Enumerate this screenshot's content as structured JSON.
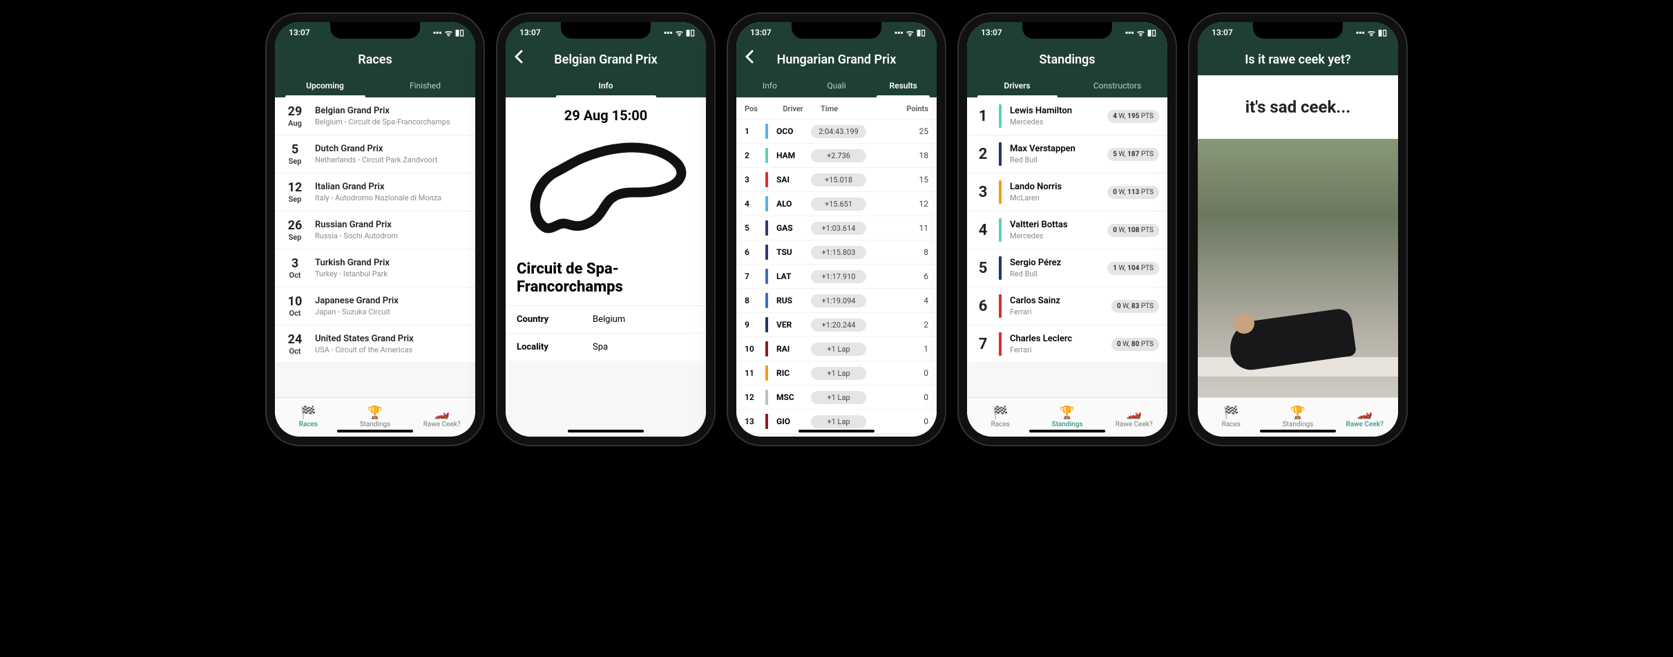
{
  "status": {
    "time": "13:07",
    "dot": "•"
  },
  "nav_labels": {
    "races": "Races",
    "standings": "Standings",
    "rawe": "Rawe Ceek?"
  },
  "screen1": {
    "title": "Races",
    "tabs": [
      "Upcoming",
      "Finished"
    ],
    "active_tab": 0,
    "races": [
      {
        "day": "29",
        "month": "Aug",
        "name": "Belgian Grand Prix",
        "loc": "Belgium - Circuit de Spa-Francorchamps"
      },
      {
        "day": "5",
        "month": "Sep",
        "name": "Dutch Grand Prix",
        "loc": "Netherlands - Circuit Park Zandvoort"
      },
      {
        "day": "12",
        "month": "Sep",
        "name": "Italian Grand Prix",
        "loc": "Italy - Autodromo Nazionale di Monza"
      },
      {
        "day": "26",
        "month": "Sep",
        "name": "Russian Grand Prix",
        "loc": "Russia - Sochi Autodrom"
      },
      {
        "day": "3",
        "month": "Oct",
        "name": "Turkish Grand Prix",
        "loc": "Turkey - Istanbul Park"
      },
      {
        "day": "10",
        "month": "Oct",
        "name": "Japanese Grand Prix",
        "loc": "Japan - Suzuka Circuit"
      },
      {
        "day": "24",
        "month": "Oct",
        "name": "United States Grand Prix",
        "loc": "USA - Circuit of the Americas"
      }
    ]
  },
  "screen2": {
    "title": "Belgian Grand Prix",
    "tab": "Info",
    "datetime": "29 Aug 15:00",
    "circuit": "Circuit de Spa-Francorchamps",
    "details": [
      {
        "k": "Country",
        "v": "Belgium"
      },
      {
        "k": "Locality",
        "v": "Spa"
      }
    ]
  },
  "screen3": {
    "title": "Hungarian Grand Prix",
    "tabs": [
      "Info",
      "Quali",
      "Results"
    ],
    "active_tab": 2,
    "columns": {
      "pos": "Pos",
      "driver": "Driver",
      "time": "Time",
      "points": "Points"
    },
    "results": [
      {
        "pos": "1",
        "code": "OCO",
        "time": "2:04:43.199",
        "pts": "25",
        "color": "#4fb5e6"
      },
      {
        "pos": "2",
        "code": "HAM",
        "time": "+2.736",
        "pts": "18",
        "color": "#5fd0b9"
      },
      {
        "pos": "3",
        "code": "SAI",
        "time": "+15.018",
        "pts": "15",
        "color": "#d92f2f"
      },
      {
        "pos": "4",
        "code": "ALO",
        "time": "+15.651",
        "pts": "12",
        "color": "#4fb5e6"
      },
      {
        "pos": "5",
        "code": "GAS",
        "time": "+1:03.614",
        "pts": "11",
        "color": "#2e3a6e"
      },
      {
        "pos": "6",
        "code": "TSU",
        "time": "+1:15.803",
        "pts": "8",
        "color": "#2e3a6e"
      },
      {
        "pos": "7",
        "code": "LAT",
        "time": "+1:17.910",
        "pts": "6",
        "color": "#3e6cc8"
      },
      {
        "pos": "8",
        "code": "RUS",
        "time": "+1:19.094",
        "pts": "4",
        "color": "#3e6cc8"
      },
      {
        "pos": "9",
        "code": "VER",
        "time": "+1:20.244",
        "pts": "2",
        "color": "#1e3866"
      },
      {
        "pos": "10",
        "code": "RAI",
        "time": "+1 Lap",
        "pts": "1",
        "color": "#8c1c1c"
      },
      {
        "pos": "11",
        "code": "RIC",
        "time": "+1 Lap",
        "pts": "0",
        "color": "#f39c12"
      },
      {
        "pos": "12",
        "code": "MSC",
        "time": "+1 Lap",
        "pts": "0",
        "color": "#bfbfbf"
      },
      {
        "pos": "13",
        "code": "GIO",
        "time": "+1 Lap",
        "pts": "0",
        "color": "#8c1c1c"
      }
    ]
  },
  "screen4": {
    "title": "Standings",
    "tabs": [
      "Drivers",
      "Constructors"
    ],
    "active_tab": 0,
    "drivers": [
      {
        "pos": "1",
        "name": "Lewis Hamilton",
        "team": "Mercedes",
        "wins": "4",
        "pts": "195",
        "color": "#5fd0b9"
      },
      {
        "pos": "2",
        "name": "Max Verstappen",
        "team": "Red Bull",
        "wins": "5",
        "pts": "187",
        "color": "#1e3866"
      },
      {
        "pos": "3",
        "name": "Lando Norris",
        "team": "McLaren",
        "wins": "0",
        "pts": "113",
        "color": "#f39c12"
      },
      {
        "pos": "4",
        "name": "Valtteri Bottas",
        "team": "Mercedes",
        "wins": "0",
        "pts": "108",
        "color": "#5fd0b9"
      },
      {
        "pos": "5",
        "name": "Sergio Pérez",
        "team": "Red Bull",
        "wins": "1",
        "pts": "104",
        "color": "#1e3866"
      },
      {
        "pos": "6",
        "name": "Carlos Sainz",
        "team": "Ferrari",
        "wins": "0",
        "pts": "83",
        "color": "#d92f2f"
      },
      {
        "pos": "7",
        "name": "Charles Leclerc",
        "team": "Ferrari",
        "wins": "0",
        "pts": "80",
        "color": "#d92f2f"
      }
    ],
    "pill_w": "W,",
    "pill_pts": "PTS"
  },
  "screen5": {
    "title": "Is it rawe ceek yet?",
    "message": "it's sad ceek..."
  }
}
